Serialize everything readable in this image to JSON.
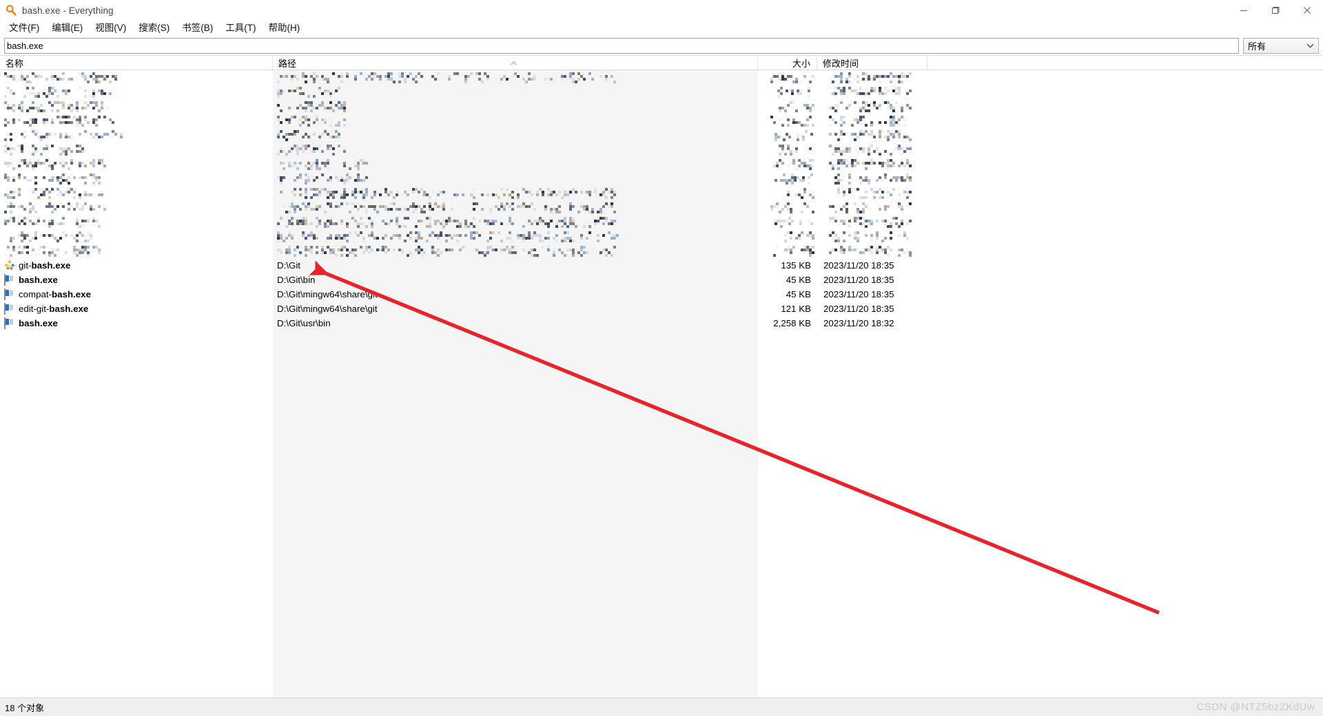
{
  "window": {
    "title": "bash.exe - Everything",
    "icon": "magnifier-icon",
    "controls": {
      "minimize": "minimize-icon",
      "maximize": "maximize-icon",
      "close": "close-icon"
    }
  },
  "menubar": {
    "items": [
      {
        "label": "文件(F)",
        "name": "menu-file"
      },
      {
        "label": "编辑(E)",
        "name": "menu-edit"
      },
      {
        "label": "视图(V)",
        "name": "menu-view"
      },
      {
        "label": "搜索(S)",
        "name": "menu-search"
      },
      {
        "label": "书签(B)",
        "name": "menu-bookmarks"
      },
      {
        "label": "工具(T)",
        "name": "menu-tools"
      },
      {
        "label": "帮助(H)",
        "name": "menu-help"
      }
    ]
  },
  "search": {
    "value": "bash.exe",
    "placeholder": "",
    "filter_selected": "所有",
    "filter_chevron": "chevron-down-icon"
  },
  "columns": [
    {
      "label": "名称",
      "name": "column-name",
      "align": "left"
    },
    {
      "label": "路径",
      "name": "column-path",
      "align": "left",
      "sort": "ascending"
    },
    {
      "label": "大小",
      "name": "column-size",
      "align": "right"
    },
    {
      "label": "修改时间",
      "name": "column-date",
      "align": "left"
    }
  ],
  "redacted_rows_count": 13,
  "rows": [
    {
      "icon": "git-bash-icon",
      "name_prefix": "git-",
      "name_match": "bash.exe",
      "path": "D:\\Git",
      "size": "135 KB",
      "date": "2023/11/20 18:35"
    },
    {
      "icon": "exe-icon",
      "name_prefix": "",
      "name_match": "bash.exe",
      "path": "D:\\Git\\bin",
      "size": "45 KB",
      "date": "2023/11/20 18:35"
    },
    {
      "icon": "exe-icon",
      "name_prefix": "compat-",
      "name_match": "bash.exe",
      "path": "D:\\Git\\mingw64\\share\\git",
      "size": "45 KB",
      "date": "2023/11/20 18:35"
    },
    {
      "icon": "exe-icon",
      "name_prefix": "edit-git-",
      "name_match": "bash.exe",
      "path": "D:\\Git\\mingw64\\share\\git",
      "size": "121 KB",
      "date": "2023/11/20 18:35"
    },
    {
      "icon": "exe-icon",
      "name_prefix": "",
      "name_match": "bash.exe",
      "path": "D:\\Git\\usr\\bin",
      "size": "2,258 KB",
      "date": "2023/11/20 18:32"
    }
  ],
  "statusbar": {
    "object_count": "18 个对象",
    "watermark": "CSDN @NTZ5bzZKdUw"
  },
  "annotation": {
    "type": "arrow",
    "color": "#e8242a",
    "points_at": "D:\\Git\\bin"
  }
}
